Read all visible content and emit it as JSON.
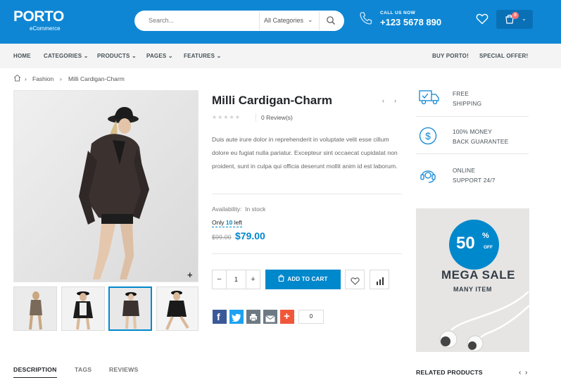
{
  "header": {
    "logo_main": "PORTO",
    "logo_sub": "eCommerce",
    "search_placeholder": "Search...",
    "search_category": "All Categories",
    "call_label": "CALL US NOW",
    "phone": "+123 5678 890",
    "cart_count": "0"
  },
  "nav": {
    "items": [
      "HOME",
      "CATEGORIES",
      "PRODUCTS",
      "PAGES",
      "FEATURES"
    ],
    "right": [
      "BUY PORTO!",
      "SPECIAL OFFER!"
    ]
  },
  "breadcrumb": [
    "Fashion",
    "Milli Cardigan-Charm"
  ],
  "product": {
    "title": "Milli Cardigan-Charm",
    "rating": 0,
    "reviews": "0 Review(s)",
    "description": "Duis aute irure dolor in reprehenderit in voluptate velit esse cillum dolore eu fugiat nulla pariatur. Excepteur sint occaecat cupidatat non proident, sunt in culpa qui officia deserunt mollit anim id est laborum.",
    "availability_label": "Availability:",
    "availability_value": "In stock",
    "only_prefix": "Only",
    "only_count": "10",
    "only_suffix": "left",
    "old_price": "$99.00",
    "price": "$79.00",
    "qty": "1",
    "add_to_cart": "ADD TO CART",
    "share_count": "0"
  },
  "tabs": [
    "DESCRIPTION",
    "TAGS",
    "REVIEWS"
  ],
  "features": [
    {
      "line1": "FREE",
      "line2": "SHIPPING",
      "icon": "truck-icon"
    },
    {
      "line1": "100% MONEY",
      "line2": "BACK GUARANTEE",
      "icon": "dollar-icon"
    },
    {
      "line1": "ONLINE",
      "line2": "SUPPORT 24/7",
      "icon": "headset-icon"
    }
  ],
  "banner": {
    "percent": "50",
    "percent_sign": "%",
    "off": "OFF",
    "title": "MEGA SALE",
    "subtitle": "MANY ITEM"
  },
  "related_title": "RELATED PRODUCTS",
  "colors": {
    "brand": "#0e86d4",
    "accent": "#0088cc",
    "badge": "#ff7272"
  }
}
